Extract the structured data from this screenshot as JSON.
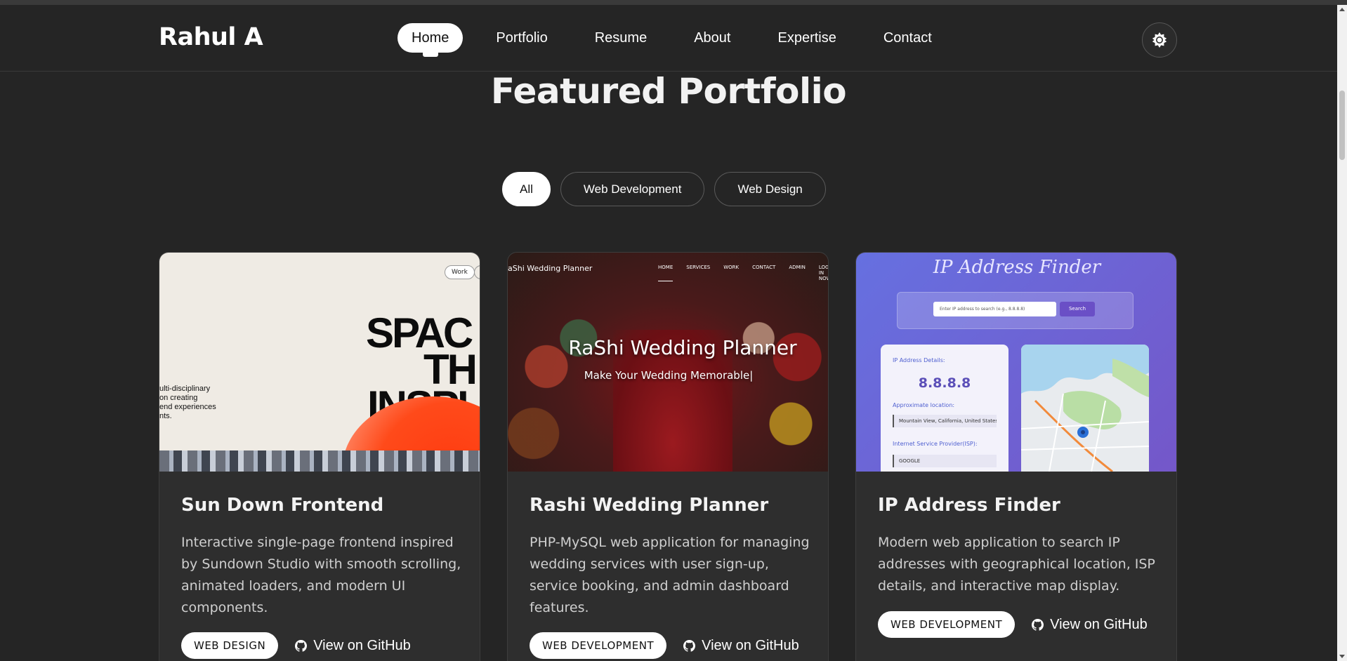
{
  "nav": {
    "brand": "Rahul A",
    "links": [
      "Home",
      "Portfolio",
      "Resume",
      "About",
      "Expertise",
      "Contact"
    ],
    "active_index": 0,
    "theme_toggle_icon": "sun-icon"
  },
  "section": {
    "title": "Featured Portfolio"
  },
  "filters": [
    "All",
    "Web Development",
    "Web Design"
  ],
  "cards": [
    {
      "title": "Sun Down Frontend",
      "description": "Interactive single-page frontend inspired by Sundown Studio with smooth scrolling, animated loaders, and modern UI components.",
      "tag": "WEB DESIGN",
      "link": "View on GitHub",
      "preview": {
        "nav_pill": "Work",
        "headline_lines": [
          "SPAC",
          "TH",
          "INSPI"
        ],
        "side_text": [
          "ulti-disciplinary",
          "on creating",
          "end experiences",
          "nts."
        ]
      }
    },
    {
      "title": "Rashi Wedding Planner",
      "description": "PHP-MySQL web application for managing wedding services with user sign-up, service booking, and admin dashboard features.",
      "tag": "WEB DEVELOPMENT",
      "link": "View on GitHub",
      "preview": {
        "brand": "aShi Wedding Planner",
        "nav_items": [
          "HOME",
          "SERVICES",
          "WORK",
          "CONTACT",
          "ADMIN",
          "LOG IN NOW"
        ],
        "heading": "RaShi Wedding Planner",
        "subheading": "Make Your Wedding Memorable|"
      }
    },
    {
      "title": "IP Address Finder",
      "description": "Modern web application to search IP addresses with geographical location, ISP details, and interactive map display.",
      "tag": "WEB DEVELOPMENT",
      "link": "View on GitHub",
      "preview": {
        "heading": "IP Address Finder",
        "input_placeholder": "Enter IP address to search (e.g., 8.8.8.8)",
        "search_button": "Search",
        "details_label": "IP Address Details:",
        "ip_value": "8.8.8.8",
        "location_label": "Approximate location:",
        "location_value": "Mountain View, California, United States.",
        "isp_label": "Internet Service Provider(ISP):",
        "isp_value": "GOOGLE"
      }
    }
  ],
  "colors": {
    "background": "#252525",
    "card": "#2e2e2e",
    "pill_active": "#ffffff"
  }
}
